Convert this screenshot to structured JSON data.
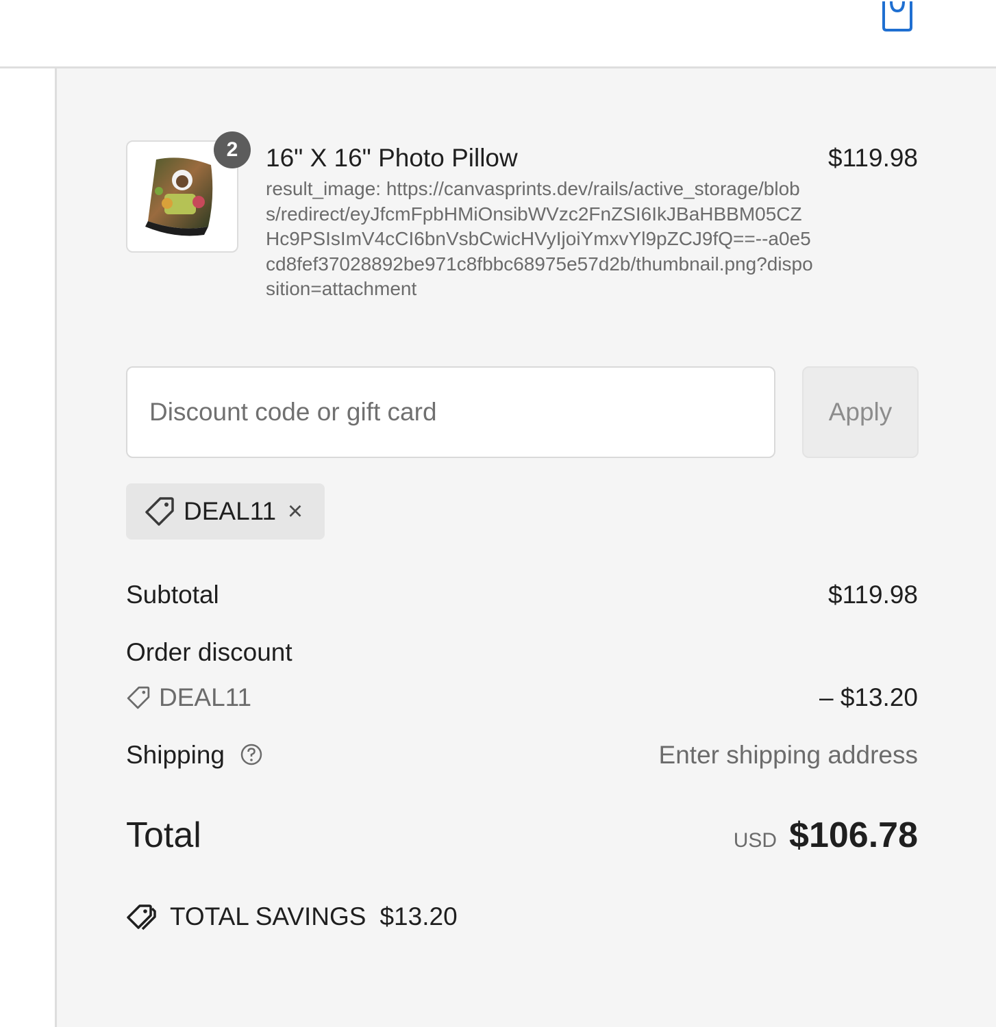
{
  "header": {
    "cart_icon": "shopping-bag-icon",
    "accent_color": "#1f6fd1"
  },
  "product": {
    "name": "16\" X 16\" Photo Pillow",
    "price": "$119.98",
    "quantity": "2",
    "property": "result_image: https://canvasprints.dev/rails/active_storage/blobs/redirect/eyJfcmFpbHMiOnsibWVzc2FnZSI6IkJBaHBBM05CZHc9PSIsImV4cCI6bnVsbCwicHVyIjoiYmxvYl9pZCJ9fQ==--a0e5cd8fef37028892be971c8fbbc68975e57d2b/thumbnail.png?disposition=attachment"
  },
  "discount": {
    "placeholder": "Discount code or gift card",
    "apply_label": "Apply",
    "applied_code": "DEAL11"
  },
  "totals": {
    "subtotal_label": "Subtotal",
    "subtotal_value": "$119.98",
    "order_discount_label": "Order discount",
    "discount_code": "DEAL11",
    "discount_value": "– $13.20",
    "shipping_label": "Shipping",
    "shipping_value": "Enter shipping address",
    "total_label": "Total",
    "currency": "USD",
    "total_value": "$106.78",
    "savings_label": "TOTAL SAVINGS",
    "savings_value": "$13.20"
  }
}
